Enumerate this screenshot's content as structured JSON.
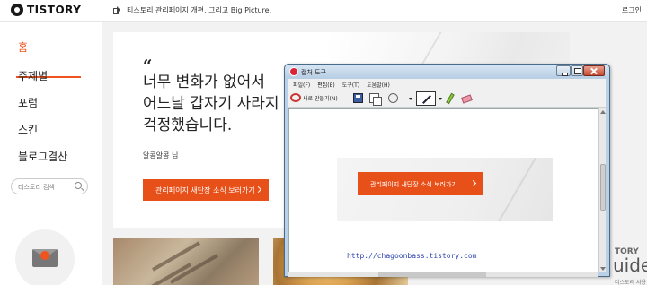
{
  "header": {
    "logo": "TISTORY",
    "notice": "티스토리 관리페이지 개편, 그리고 Big Picture.",
    "login": "로그인"
  },
  "sidebar": {
    "items": [
      {
        "label": "홈",
        "active": true
      },
      {
        "label": "주제별"
      },
      {
        "label": "포럼"
      },
      {
        "label": "스킨"
      },
      {
        "label": "블로그결산"
      }
    ],
    "search_placeholder": "티스토리 검색"
  },
  "hero": {
    "quote_mark": "“",
    "quote_line1": "너무 변화가 없어서",
    "quote_line2": "어느날 갑자기 사라지",
    "quote_line3": "걱정했습니다.",
    "author": "알콩알콩 님",
    "cta_label": "관리페이지 새단장 소식 보러가기"
  },
  "guide_card": {
    "top": "TORY",
    "big": "uide",
    "small": "티스토리 사용법을"
  },
  "snipping_tool": {
    "title": "캡처 도구",
    "menu": [
      "파일(F)",
      "편집(E)",
      "도구(T)",
      "도움말(H)"
    ],
    "new_label": "새로 만들기(N)",
    "captured_cta": "관리페이지 새단장 소식 보러가기",
    "watermark": "http://chagoonbass.tistory.com"
  },
  "colors": {
    "accent": "#f0541e",
    "cta": "#e8501a"
  }
}
